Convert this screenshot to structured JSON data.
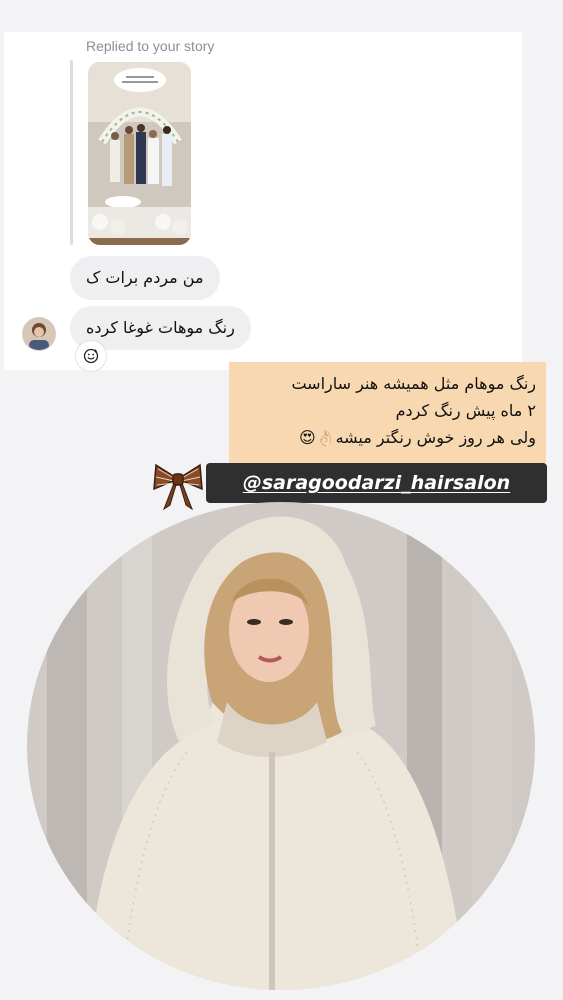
{
  "dm": {
    "replied_label": "Replied to your story",
    "messages": [
      {
        "text": "من مردم برات ک"
      },
      {
        "text": "رنگ موهات غوغا کرده"
      }
    ],
    "reaction_icon": "emoji-smile-icon"
  },
  "story": {
    "caption_lines": [
      "رنگ موهام مثل همیشه هنر ساراست",
      "۲ ماه پیش رنگ کردم",
      "ولی هر روز خوش رنگتر میشه👌🏻😍"
    ],
    "mention": "@saragoodarzi_hairsalon",
    "caption_bg": "#f8d8b0",
    "mention_bg": "#2f2f2f"
  }
}
